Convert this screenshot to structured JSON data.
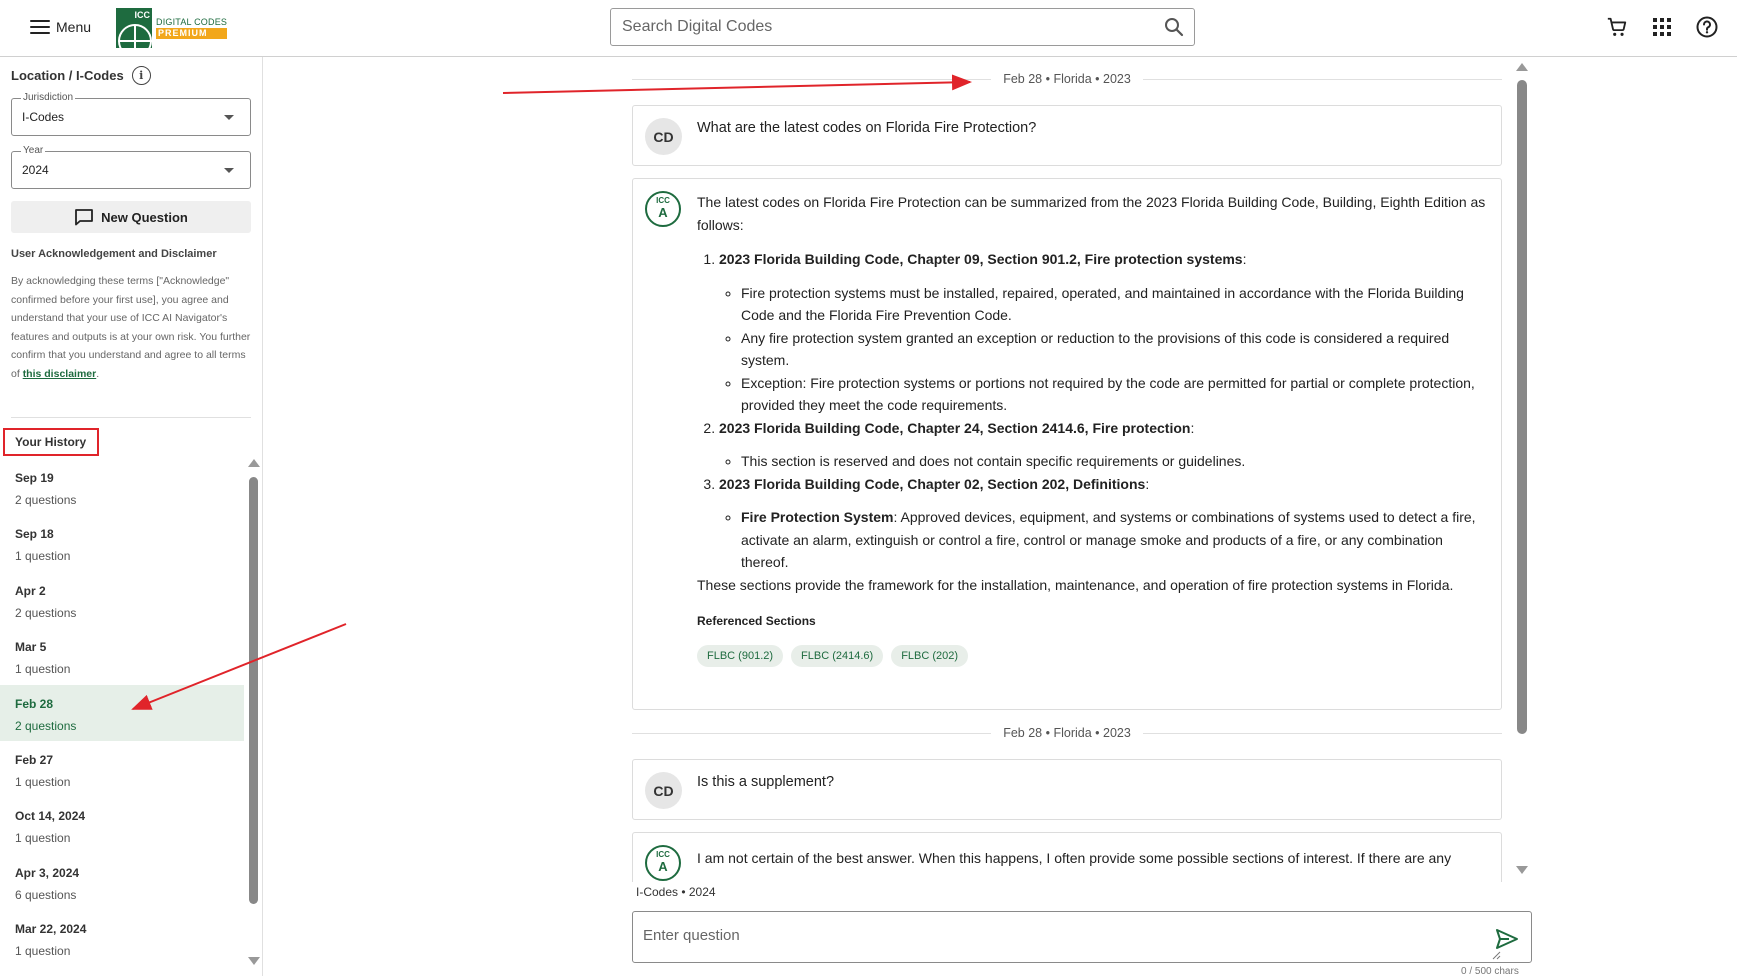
{
  "header": {
    "menu_label": "Menu",
    "logo_mark": "ICC",
    "logo_line1": "DIGITAL CODES",
    "logo_line2": "PREMIUM",
    "search_placeholder": "Search Digital Codes",
    "icons": [
      "cart-icon",
      "apps-grid-icon",
      "help-icon"
    ]
  },
  "sidebar": {
    "location_title": "Location / I-Codes",
    "jurisdiction": {
      "label": "Jurisdiction",
      "value": "I-Codes"
    },
    "year": {
      "label": "Year",
      "value": "2024"
    },
    "new_question_label": "New Question",
    "disclaimer_title": "User Acknowledgement and Disclaimer",
    "disclaimer_text": "By acknowledging these terms [\"Acknowledge\" confirmed before your first use], you agree and understand that your use of ICC AI Navigator's features and outputs is at your own risk. You further confirm that you understand and agree to all terms of ",
    "disclaimer_link": "this disclaimer",
    "disclaimer_end": ".",
    "history_title": "Your History",
    "history": [
      {
        "date": "Sep 19",
        "count": "2 questions"
      },
      {
        "date": "Sep 18",
        "count": "1 question"
      },
      {
        "date": "Apr 2",
        "count": "2 questions"
      },
      {
        "date": "Mar 5",
        "count": "1 question"
      },
      {
        "date": "Feb 28",
        "count": "2 questions",
        "active": true
      },
      {
        "date": "Feb 27",
        "count": "1 question"
      },
      {
        "date": "Oct 14, 2024",
        "count": "1 question"
      },
      {
        "date": "Apr 3, 2024",
        "count": "6 questions"
      },
      {
        "date": "Mar 22, 2024",
        "count": "1 question"
      }
    ]
  },
  "chat": {
    "separator1": "Feb 28 • Florida • 2023",
    "q1": {
      "avatar": "CD",
      "text": "What are the latest codes on Florida Fire Protection?"
    },
    "a1": {
      "avatar_top": "ICC",
      "avatar_letter": "A",
      "intro": "The latest codes on Florida Fire Protection can be summarized from the 2023 Florida Building Code, Building, Eighth Edition as follows:",
      "sections": [
        {
          "title": "2023 Florida Building Code, Chapter 09, Section 901.2, Fire protection systems",
          "bullets": [
            "Fire protection systems must be installed, repaired, operated, and maintained in accordance with the Florida Building Code and the Florida Fire Prevention Code.",
            "Any fire protection system granted an exception or reduction to the provisions of this code is considered a required system.",
            "Exception: Fire protection systems or portions not required by the code are permitted for partial or complete protection, provided they meet the code requirements."
          ]
        },
        {
          "title": "2023 Florida Building Code, Chapter 24, Section 2414.6, Fire protection",
          "bullets": [
            "This section is reserved and does not contain specific requirements or guidelines."
          ]
        },
        {
          "title": "2023 Florida Building Code, Chapter 02, Section 202, Definitions",
          "bullet_term": "Fire Protection System",
          "bullet_rest": ": Approved devices, equipment, and systems or combinations of systems used to detect a fire, activate an alarm, extinguish or control a fire, control or manage smoke and products of a fire, or any combination thereof."
        }
      ],
      "closing": "These sections provide the framework for the installation, maintenance, and operation of fire protection systems in Florida.",
      "refs_title": "Referenced Sections",
      "refs": [
        "FLBC (901.2)",
        "FLBC (2414.6)",
        "FLBC (202)"
      ]
    },
    "separator2": "Feb 28 • Florida • 2023",
    "q2": {
      "avatar": "CD",
      "text": "Is this a supplement?"
    },
    "a2": {
      "text": "I am not certain of the best answer. When this happens, I often provide some possible sections of interest. If there are any sections listed here please look into them. Otherwise please re-word your question and try again."
    },
    "context": "I-Codes • 2024",
    "input_placeholder": "Enter question",
    "char_count": "0 / 500 chars"
  },
  "colors": {
    "brand_green": "#1e6b3f",
    "accent_orange": "#f2a71b",
    "annotation_red": "#e0242a"
  }
}
